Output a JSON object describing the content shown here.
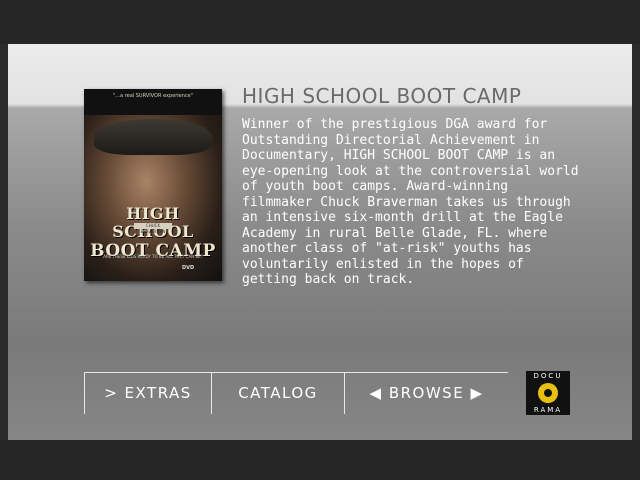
{
  "title": "HIGH SCHOOL BOOT CAMP",
  "description": "Winner of the prestigious DGA award for Outstanding Directorial Achievement in Documentary, HIGH SCHOOL BOOT CAMP is an eye-opening look at the controversial world of youth boot camps. Award-winning filmmaker Chuck Braverman takes us through an intensive six-month drill at the Eagle Academy in rural Belle Glade, FL. where another class of \"at-risk\" youths has voluntarily enlisted in the hopes of getting back on track.",
  "poster": {
    "quote": "\"...a real SURVIVOR experience\"",
    "title_line1": "HIGH SCHOOL",
    "title_line2": "BOOT CAMP",
    "tag": "CHUCK BRAVERMAN",
    "tagline": "ARE THESE KIDS READY TO BE ALL THEY CAN BE?",
    "dvd": "DVD"
  },
  "menu": {
    "extras": "> EXTRAS",
    "catalog": "CATALOG",
    "browse": "◀ BROWSE ▶"
  },
  "logo": {
    "top": "DOCU",
    "bottom": "RAMA",
    "accent": "#e8c012"
  }
}
